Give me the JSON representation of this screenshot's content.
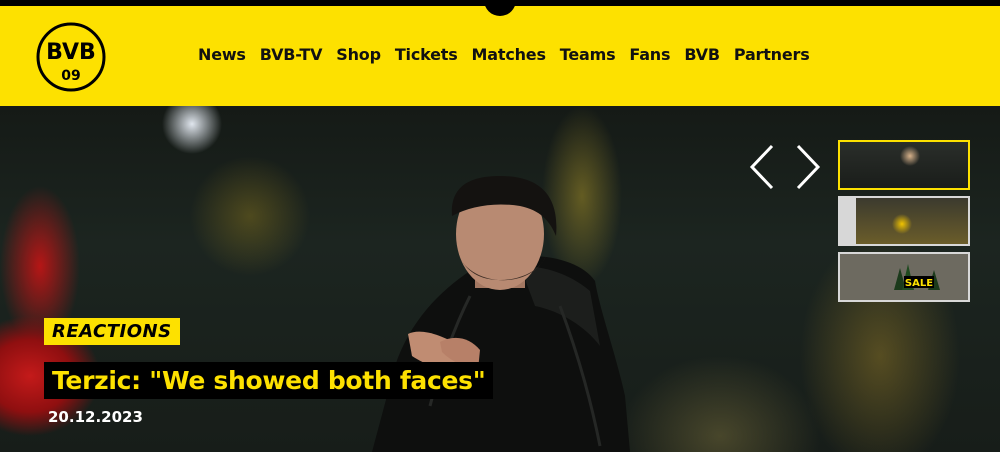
{
  "colors": {
    "brand_yellow": "#fde100",
    "black": "#000000",
    "white": "#ffffff"
  },
  "logo": {
    "letters": "BVB",
    "year": "09",
    "icon": "bvb-logo"
  },
  "nav": {
    "items": [
      {
        "label": "News"
      },
      {
        "label": "BVB-TV"
      },
      {
        "label": "Shop"
      },
      {
        "label": "Tickets"
      },
      {
        "label": "Matches"
      },
      {
        "label": "Teams"
      },
      {
        "label": "Fans"
      },
      {
        "label": "BVB"
      },
      {
        "label": "Partners"
      }
    ]
  },
  "hero": {
    "category": "REACTIONS",
    "headline": "Terzic: \"We showed both faces\"",
    "date": "20.12.2023",
    "prev_icon": "chevron-left-icon",
    "next_icon": "chevron-right-icon"
  },
  "thumbnails": [
    {
      "name": "thumbnail-1",
      "active": true
    },
    {
      "name": "thumbnail-2",
      "active": false
    },
    {
      "name": "thumbnail-3",
      "active": false,
      "logo_text": "SALE"
    }
  ]
}
